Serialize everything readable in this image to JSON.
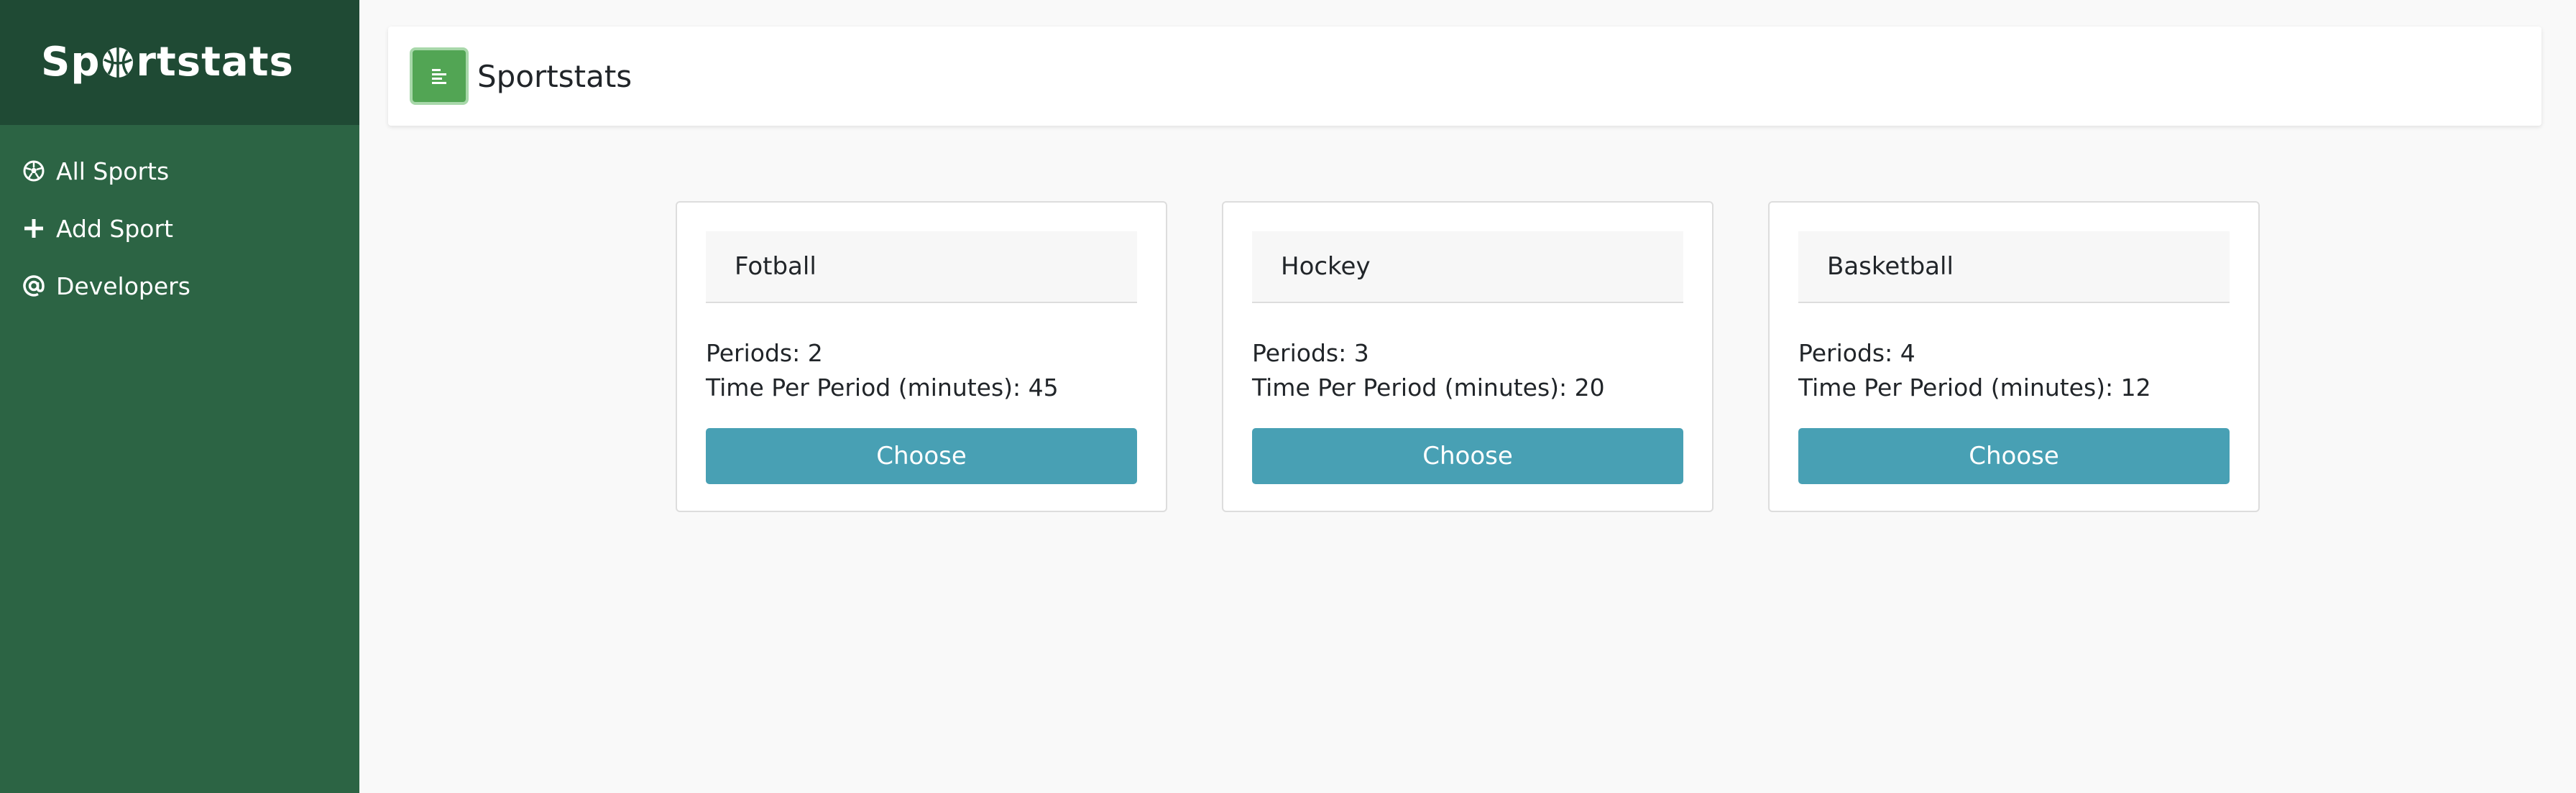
{
  "sidebar": {
    "brand_pre": "Sp",
    "brand_post": "rtstats",
    "brand_icon": "basketball-icon",
    "items": [
      {
        "label": "All Sports",
        "icon": "soccer-ball-icon"
      },
      {
        "label": "Add Sport",
        "icon": "plus-icon"
      },
      {
        "label": "Developers",
        "icon": "at-icon"
      }
    ]
  },
  "topbar": {
    "title": "Sportstats",
    "toggle_icon": "menu-align-left-icon"
  },
  "cards": [
    {
      "title": "Fotball",
      "periods": "Periods: 2",
      "time": "Time Per Period (minutes): 45",
      "button": "Choose"
    },
    {
      "title": "Hockey",
      "periods": "Periods: 3",
      "time": "Time Per Period (minutes): 20",
      "button": "Choose"
    },
    {
      "title": "Basketball",
      "periods": "Periods: 4",
      "time": "Time Per Period (minutes): 12",
      "button": "Choose"
    }
  ],
  "colors": {
    "sidebar_bg": "#2c6444",
    "sidebar_header_bg": "#1f4a34",
    "toggle_bg": "#52a554",
    "button_bg": "#48a0b4",
    "page_bg": "#f9f9f9"
  }
}
